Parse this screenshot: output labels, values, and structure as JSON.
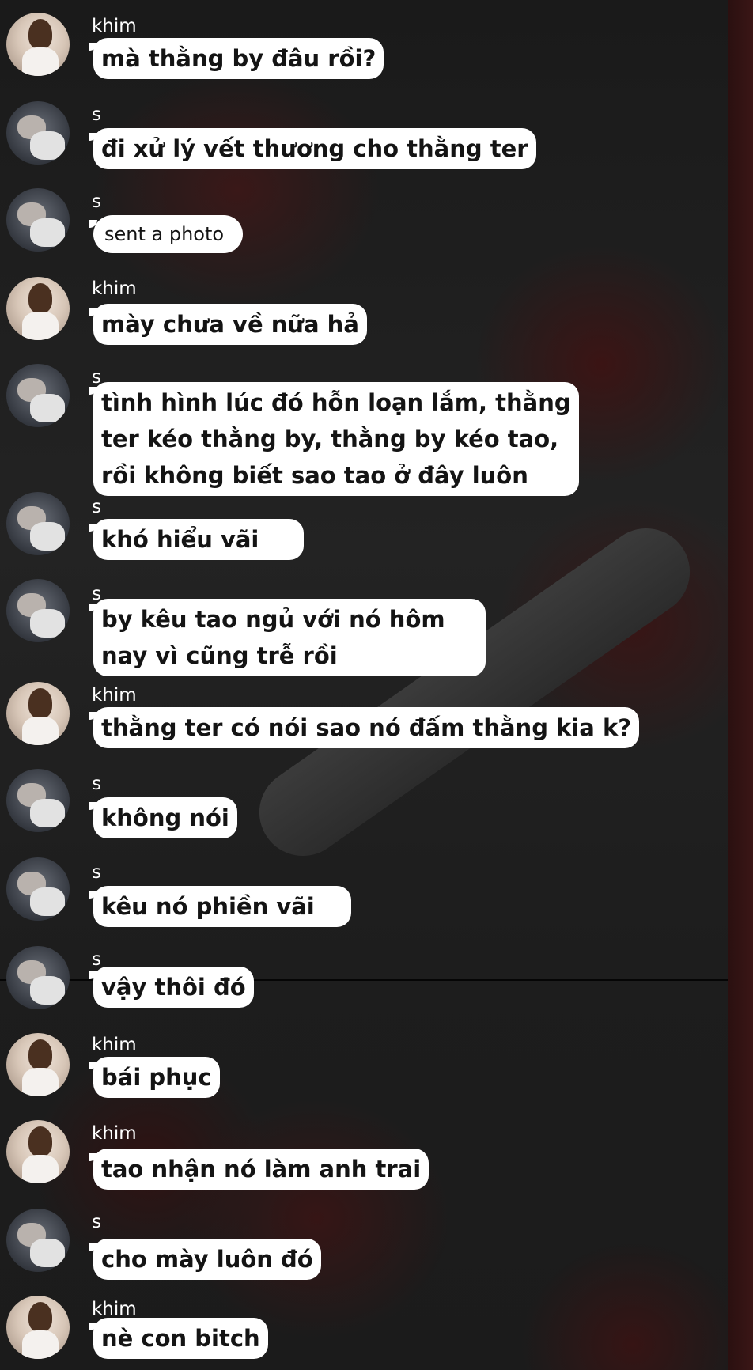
{
  "messages": [
    {
      "sender": "khim",
      "text": "mà thằng by đâu rồi?"
    },
    {
      "sender": "s",
      "text": "đi xử lý vết thương cho thằng ter"
    },
    {
      "sender": "s",
      "text": "sent a photo"
    },
    {
      "sender": "khim",
      "text": "mày chưa về nữa hả"
    },
    {
      "sender": "s",
      "text": "tình hình lúc đó hỗn loạn lắm, thằng\nter kéo thằng by, thằng by kéo tao,\nrồi không biết sao tao ở đây luôn"
    },
    {
      "sender": "s",
      "text": "khó hiểu vãi"
    },
    {
      "sender": "s",
      "text": "by kêu tao ngủ với nó hôm\nnay vì cũng trễ rồi"
    },
    {
      "sender": "khim",
      "text": "thằng ter có nói sao nó đấm thằng kia k?"
    },
    {
      "sender": "s",
      "text": "không nói"
    },
    {
      "sender": "s",
      "text": "kêu nó phiền vãi"
    },
    {
      "sender": "s",
      "text": "vậy thôi đó"
    },
    {
      "sender": "khim",
      "text": "bái phục"
    },
    {
      "sender": "khim",
      "text": "tao nhận nó làm anh trai"
    },
    {
      "sender": "s",
      "text": "cho mày luôn đó"
    },
    {
      "sender": "khim",
      "text": "nè con bitch"
    }
  ]
}
